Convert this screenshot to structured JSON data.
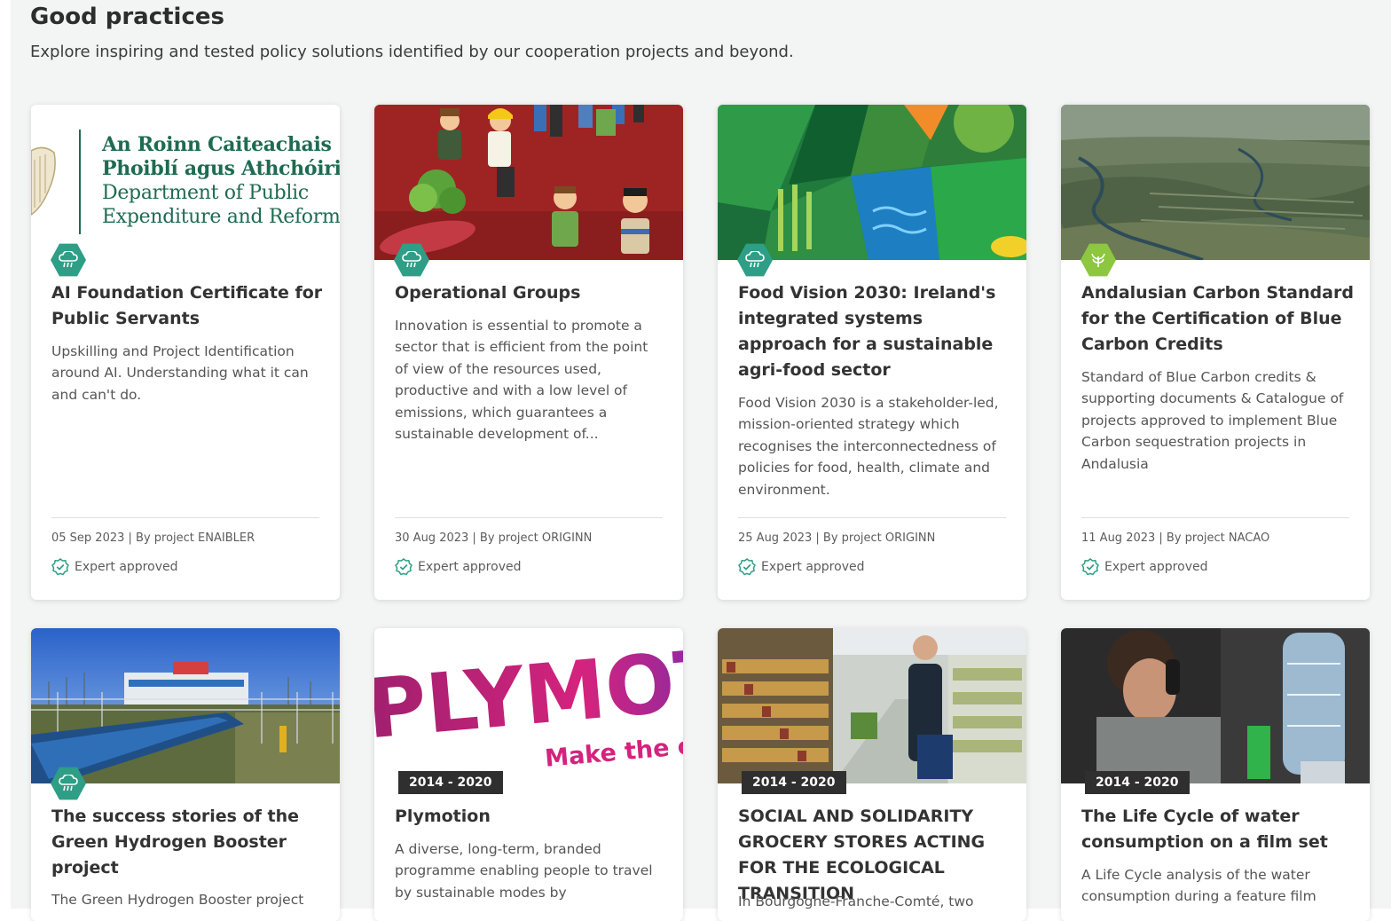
{
  "section": {
    "title": "Good practices",
    "subtitle": "Explore inspiring and tested policy solutions identified by our cooperation projects and beyond."
  },
  "colors": {
    "badge_teal": "#2e9e86",
    "badge_lime": "#8dc63f",
    "expert_check": "#2e9e86"
  },
  "cards": [
    {
      "logo_text": [
        "An Roinn Caiteachais",
        "Phoiblí agus Athchóirithe",
        "Department of Public",
        "Expenditure and Reform"
      ],
      "badge_icon": "cloud-rain-icon",
      "title": "AI Foundation Certificate for Public Servants",
      "description": "Upskilling and Project Identification around AI. Understanding what it can and can't do.",
      "meta": "05 Sep 2023 | By project ENAIBLER",
      "status": "Expert approved"
    },
    {
      "badge_icon": "cloud-rain-icon",
      "title": "Operational Groups",
      "description": "Innovation is essential to promote a sector that is efficient from the point of view of the resources used, productive and with a low level of emissions, which guarantees a sustainable development of...",
      "meta": "30 Aug 2023 | By project ORIGINN",
      "status": "Expert approved"
    },
    {
      "badge_icon": "cloud-rain-icon",
      "title": "Food Vision 2030: Ireland's integrated systems approach for a sustainable agri-food sector",
      "description": "Food Vision 2030 is a stakeholder-led, mission-oriented strategy which recognises the interconnectedness of policies for food, health, climate and environment.",
      "meta": "25 Aug 2023 | By project ORIGINN",
      "status": "Expert approved"
    },
    {
      "badge_icon": "leaf-icon",
      "title": "Andalusian Carbon Standard for the Certification of Blue Carbon Credits",
      "description": "Standard of Blue Carbon credits & supporting documents & Catalogue of projects approved to implement Blue Carbon sequestration projects in Andalusia",
      "meta": "11 Aug 2023 | By project NACAO",
      "status": "Expert approved"
    },
    {
      "badge_icon": "cloud-rain-icon",
      "title": "The success stories of the Green Hydrogen Booster project",
      "description": "The Green Hydrogen Booster project"
    },
    {
      "logo_text": "PLYMOT",
      "logo_tagline": "Make the c",
      "period": "2014 - 2020",
      "title": "Plymotion",
      "description": "A diverse, long-term, branded programme enabling people to travel by sustainable modes by"
    },
    {
      "period": "2014 - 2020",
      "title": "SOCIAL AND SOLIDARITY GROCERY STORES ACTING FOR THE ECOLOGICAL TRANSITION",
      "description": "In Bourgogne-Franche-Comté, two"
    },
    {
      "period": "2014 - 2020",
      "title": "The Life Cycle of water consumption on a film set",
      "description": "A Life Cycle analysis of the water consumption during a feature film"
    }
  ]
}
